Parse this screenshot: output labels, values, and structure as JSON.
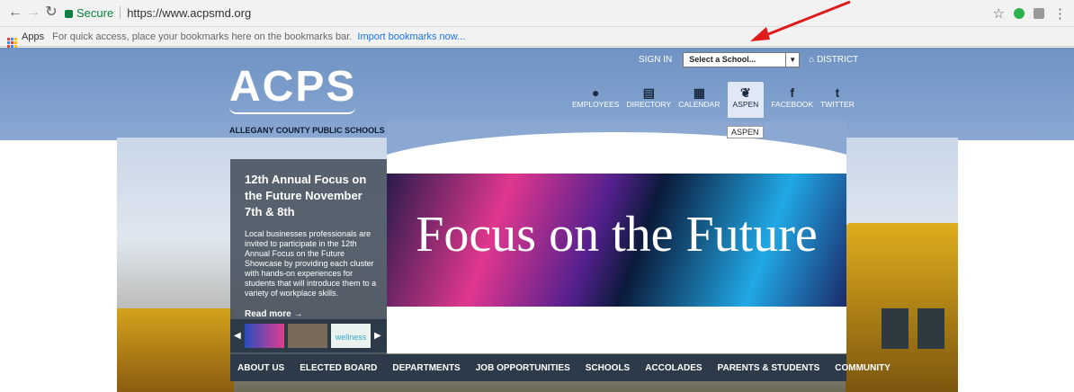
{
  "browser": {
    "secure_label": "Secure",
    "url": "https://www.acpsmd.org",
    "bookmarks": {
      "apps_label": "Apps",
      "hint": "For quick access, place your bookmarks here on the bookmarks bar.",
      "import_link": "Import bookmarks now..."
    }
  },
  "header": {
    "sign_in": "SIGN IN",
    "school_select_placeholder": "Select a School...",
    "district": "DISTRICT",
    "logo": "ACPS",
    "logo_subtitle": "ALLEGANY COUNTY PUBLIC SCHOOLS",
    "quicknav": [
      {
        "label": "EMPLOYEES",
        "icon": "apple-icon"
      },
      {
        "label": "DIRECTORY",
        "icon": "id-card-icon"
      },
      {
        "label": "CALENDAR",
        "icon": "calendar-icon"
      },
      {
        "label": "ASPEN",
        "icon": "leaf-icon",
        "active": true
      },
      {
        "label": "FACEBOOK",
        "icon": "facebook-icon"
      },
      {
        "label": "TWITTER",
        "icon": "twitter-icon"
      }
    ],
    "tooltip": "ASPEN"
  },
  "hero": {
    "banner_text": "Focus on the Future"
  },
  "news": {
    "title": "12th Annual Focus on the Future November 7th & 8th",
    "body": "Local businesses professionals are invited to participate in the 12th Annual Focus on the Future Showcase by providing each cluster with hands-on experiences for students that will introduce them to a variety of workplace skills.",
    "read_more": "Read more  →",
    "thumb3_label": "wellness"
  },
  "main_nav": [
    "ABOUT US",
    "ELECTED BOARD",
    "DEPARTMENTS",
    "JOB OPPORTUNITIES",
    "SCHOOLS",
    "ACCOLADES",
    "PARENTS & STUDENTS",
    "COMMUNITY"
  ],
  "colors": {
    "header_blue": "#7f9ecb",
    "nav_dark": "#2c3a4a",
    "annotation_arrow": "#e0191b"
  }
}
